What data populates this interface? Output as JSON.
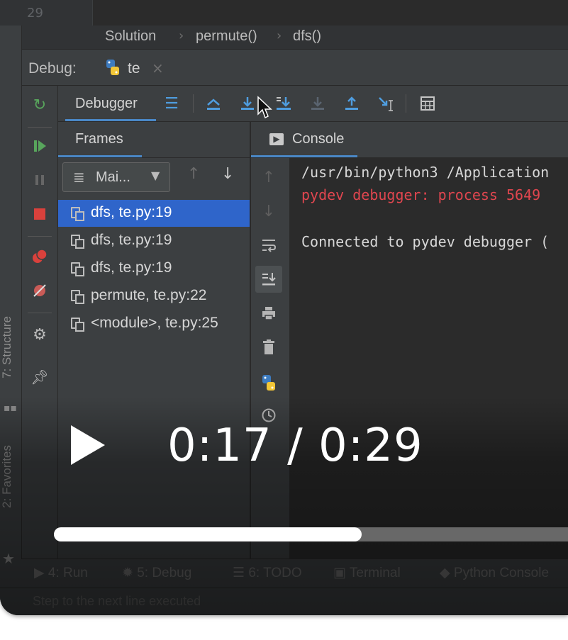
{
  "editor": {
    "line_number": "29"
  },
  "breadcrumb": {
    "items": [
      "Solution",
      "permute()",
      "dfs()"
    ]
  },
  "debug_bar": {
    "label": "Debug:",
    "tab_name": "te",
    "tab_close": "×"
  },
  "left_strip": {
    "structure_tab": "7: Structure",
    "favorites_tab": "2: Favorites"
  },
  "toolbar": {
    "debugger_tab": "Debugger"
  },
  "frames": {
    "tab_label": "Frames",
    "thread": "Mai...",
    "items": [
      {
        "label": "dfs, te.py:19",
        "selected": true
      },
      {
        "label": "dfs, te.py:19",
        "selected": false
      },
      {
        "label": "dfs, te.py:19",
        "selected": false
      },
      {
        "label": "permute, te.py:22",
        "selected": false
      },
      {
        "label": "<module>, te.py:25",
        "selected": false
      }
    ]
  },
  "console": {
    "tab_label": "Console",
    "lines": [
      {
        "text": "/usr/bin/python3 /Application",
        "color": "#d7d7d7"
      },
      {
        "text": "pydev debugger: process 5649",
        "color": "#e0464f"
      },
      {
        "text": "Connected to pydev debugger (",
        "color": "#d7d7d7"
      }
    ]
  },
  "bottom_tabs": [
    "4: Run",
    "5: Debug",
    "6: TODO",
    "Terminal",
    "Python Console"
  ],
  "status": {
    "text": "Step to the next line executed"
  },
  "video": {
    "time": "0:17 / 0:29",
    "progress": 0.586
  },
  "colors": {
    "selection": "#2f65ca",
    "accent": "#4a88c7",
    "error_text": "#e0464f"
  }
}
